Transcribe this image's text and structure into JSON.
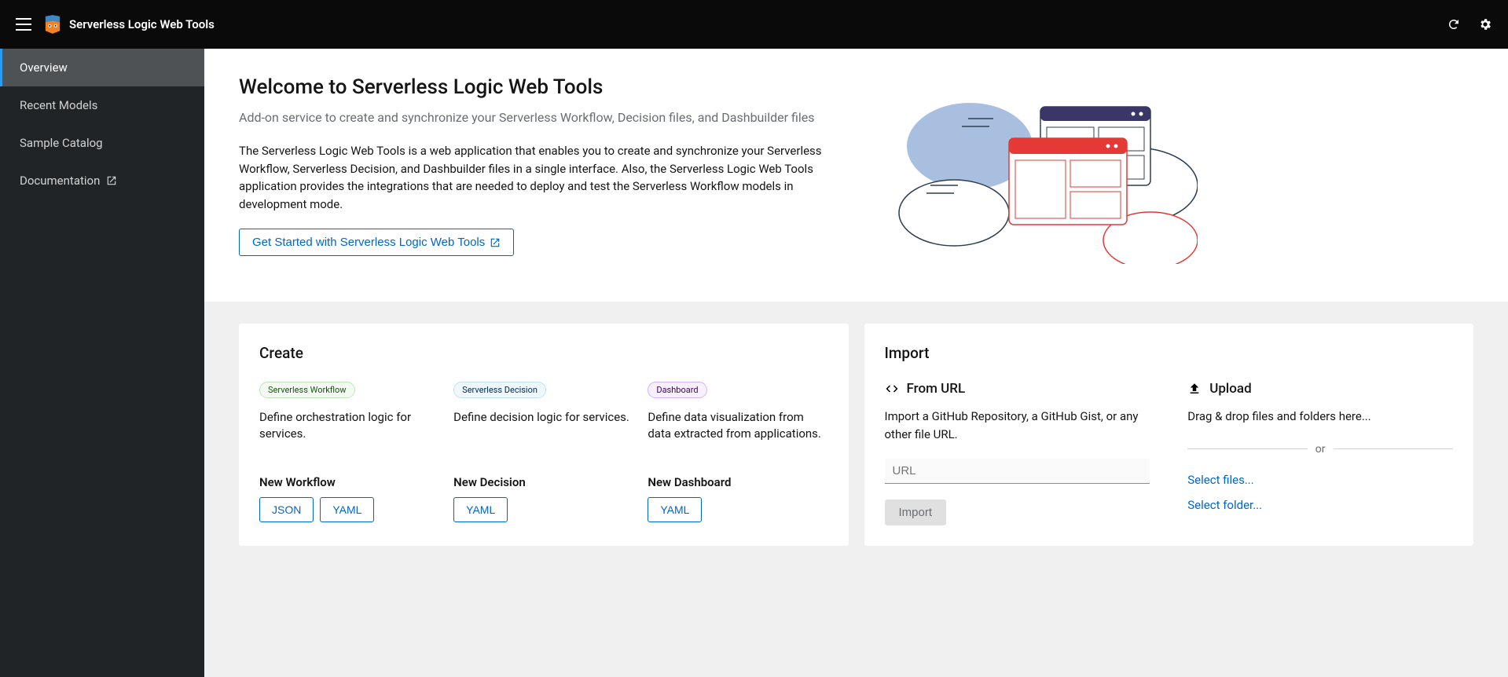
{
  "header": {
    "title": "Serverless Logic Web Tools"
  },
  "sidebar": {
    "items": [
      {
        "label": "Overview",
        "active": true,
        "external": false
      },
      {
        "label": "Recent Models",
        "active": false,
        "external": false
      },
      {
        "label": "Sample Catalog",
        "active": false,
        "external": false
      },
      {
        "label": "Documentation",
        "active": false,
        "external": true
      }
    ]
  },
  "hero": {
    "title": "Welcome to Serverless Logic Web Tools",
    "subtitle": "Add-on service to create and synchronize your Serverless Workflow, Decision files, and Dashbuilder files",
    "description": "The Serverless Logic Web Tools is a web application that enables you to create and synchronize your Serverless Workflow, Serverless Decision, and Dashbuilder files in a single interface. Also, the Serverless Logic Web Tools application provides the integrations that are needed to deploy and test the Serverless Workflow models in development mode.",
    "cta": "Get Started with Serverless Logic Web Tools"
  },
  "create": {
    "title": "Create",
    "cols": [
      {
        "badge": "Serverless Workflow",
        "badgeClass": "badge-workflow",
        "desc": "Define orchestration logic for services.",
        "sub": "New Workflow",
        "buttons": [
          "JSON",
          "YAML"
        ]
      },
      {
        "badge": "Serverless Decision",
        "badgeClass": "badge-decision",
        "desc": "Define decision logic for services.",
        "sub": "New Decision",
        "buttons": [
          "YAML"
        ]
      },
      {
        "badge": "Dashboard",
        "badgeClass": "badge-dashboard",
        "desc": "Define data visualization from data extracted from applications.",
        "sub": "New Dashboard",
        "buttons": [
          "YAML"
        ]
      }
    ]
  },
  "import": {
    "title": "Import",
    "fromUrl": {
      "heading": "From URL",
      "desc": "Import a GitHub Repository, a GitHub Gist, or any other file URL.",
      "placeholder": "URL",
      "button": "Import"
    },
    "upload": {
      "heading": "Upload",
      "desc": "Drag & drop files and folders here...",
      "or": "or",
      "selectFiles": "Select files...",
      "selectFolder": "Select folder..."
    }
  }
}
